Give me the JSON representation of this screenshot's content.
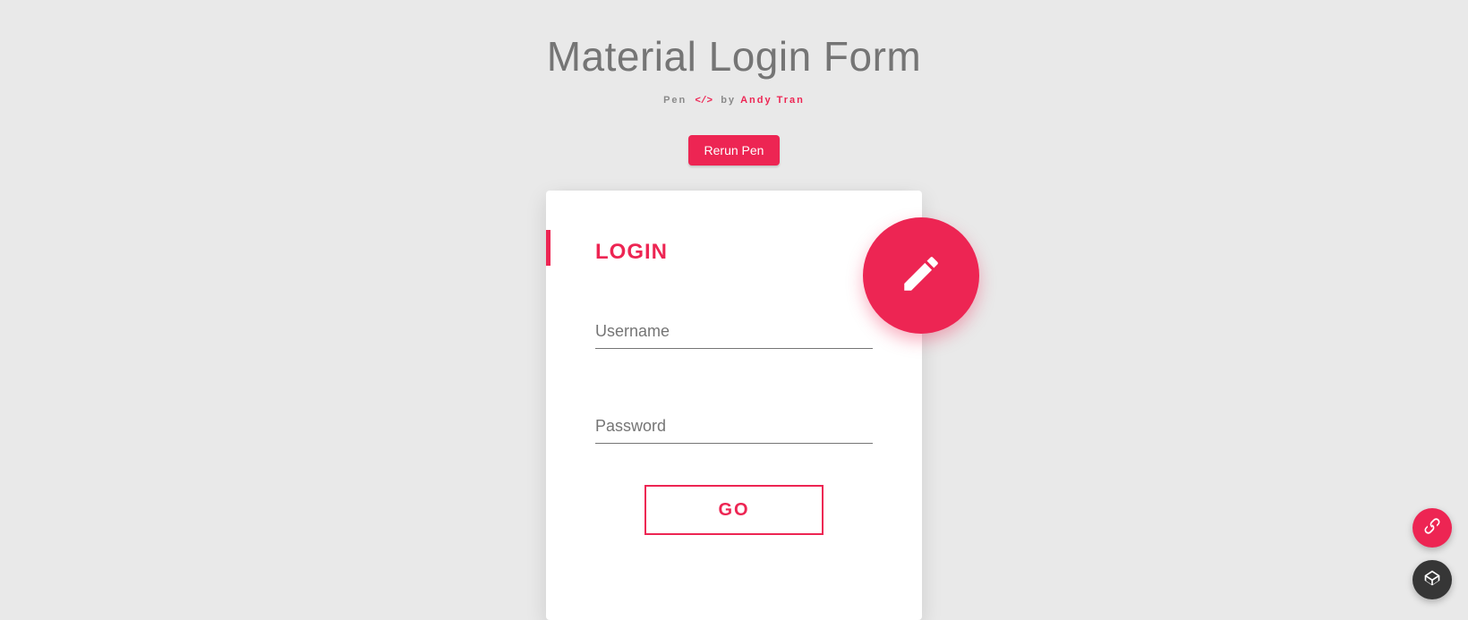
{
  "header": {
    "title": "Material Login Form",
    "byline_prefix": "Pen",
    "byline_by": "by",
    "author": "Andy Tran"
  },
  "actions": {
    "rerun": "Rerun Pen"
  },
  "card": {
    "title": "LOGIN",
    "username": {
      "value": "",
      "placeholder": "Username"
    },
    "password": {
      "value": "",
      "placeholder": "Password"
    },
    "submit": "GO"
  },
  "icons": {
    "fab": "pencil-icon",
    "side_link": "link-icon",
    "side_codepen": "codepen-icon"
  },
  "colors": {
    "accent": "#ed2553",
    "background": "#e9e9e9",
    "dark": "#363636"
  }
}
